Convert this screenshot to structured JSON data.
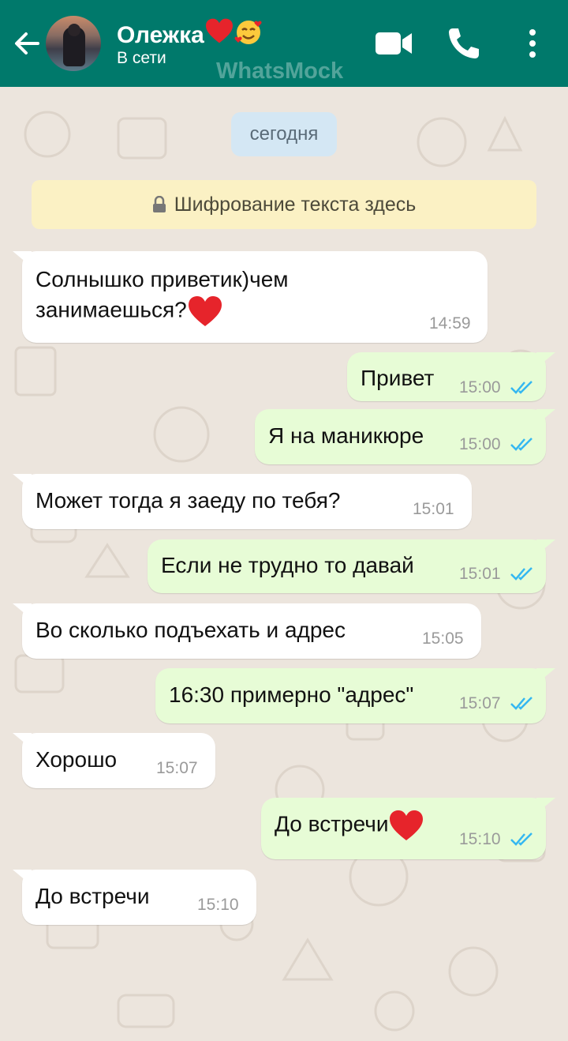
{
  "header": {
    "contact_name": "Олежка",
    "name_emojis": [
      "red-heart",
      "smiling-face-with-hearts"
    ],
    "status": "В сети",
    "watermark": "WhatsMock",
    "color": "#00796b"
  },
  "chat": {
    "date_label": "сегодня",
    "encryption_notice": "Шифрование текста здесь",
    "incoming_color": "#ffffff",
    "outgoing_color": "#e7fcd6",
    "tick_color": "#34b7f1",
    "messages": [
      {
        "dir": "in",
        "lines": [
          "Солнышко приветик)чем",
          "занимаешься?"
        ],
        "emoji": "red-heart",
        "time": "14:59"
      },
      {
        "dir": "out",
        "text": "Привет",
        "time": "15:00",
        "read": true
      },
      {
        "dir": "out",
        "text": "Я на маникюре",
        "time": "15:00",
        "read": true
      },
      {
        "dir": "in",
        "text": "Может тогда я заеду по тебя?",
        "time": "15:01"
      },
      {
        "dir": "out",
        "text": "Если не трудно то давай",
        "time": "15:01",
        "read": true
      },
      {
        "dir": "in",
        "text": "Во сколько подъехать и адрес",
        "time": "15:05"
      },
      {
        "dir": "out",
        "text": "16:30 примерно \"адрес\"",
        "time": "15:07",
        "read": true
      },
      {
        "dir": "in",
        "text": "Хорошо",
        "time": "15:07"
      },
      {
        "dir": "out",
        "text": "До встречи",
        "emoji": "red-heart",
        "time": "15:10",
        "read": true
      },
      {
        "dir": "in",
        "text": "До встречи",
        "time": "15:10"
      }
    ]
  }
}
